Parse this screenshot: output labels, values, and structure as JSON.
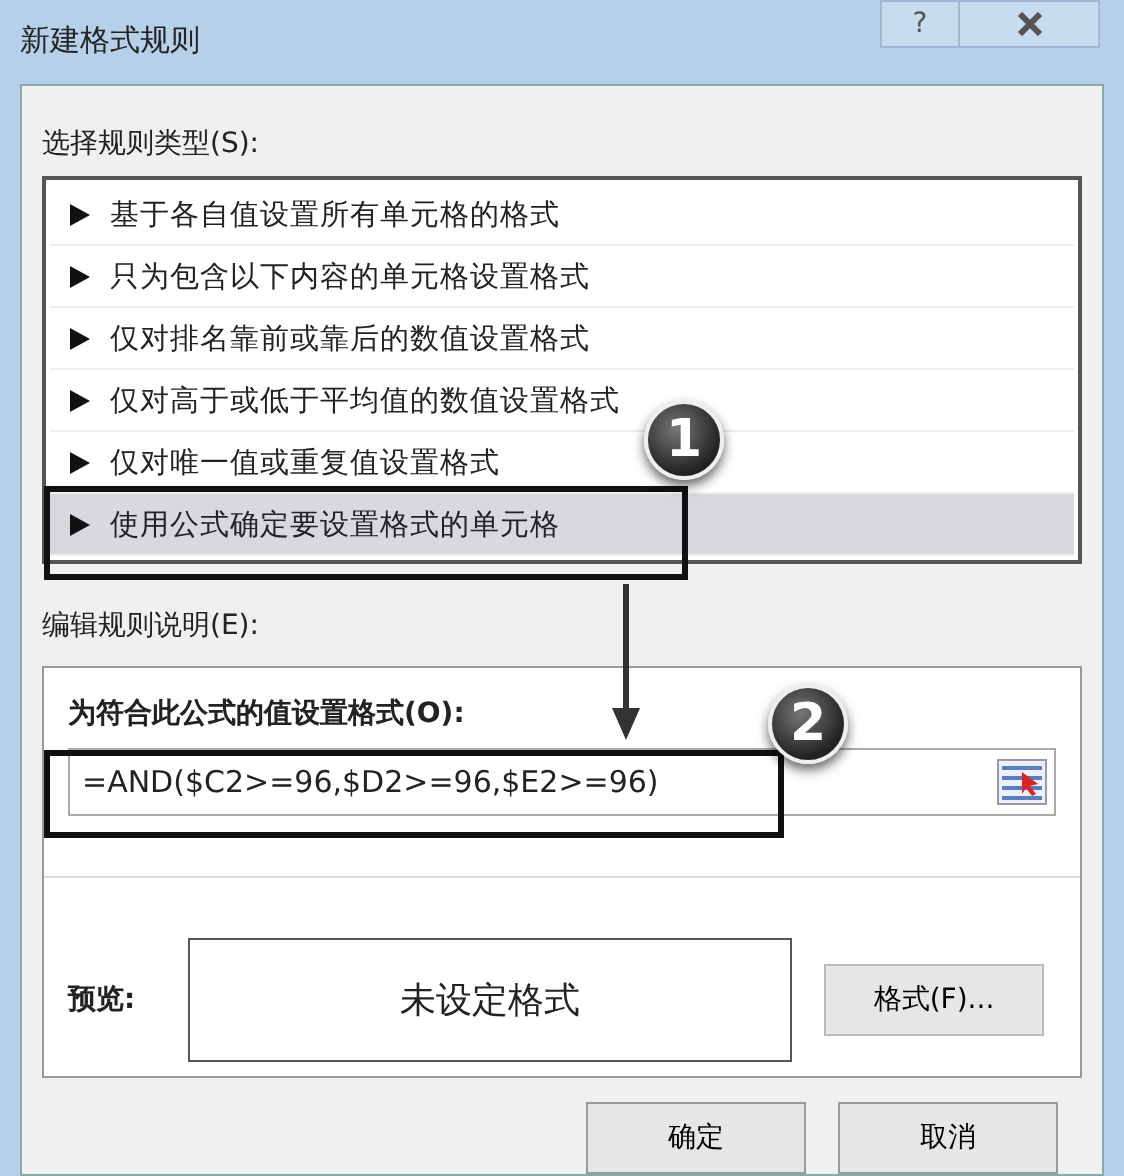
{
  "window": {
    "title": "新建格式规则",
    "help_button": "?"
  },
  "rule_type_label": "选择规则类型(S):",
  "rule_types": [
    {
      "label": "基于各自值设置所有单元格的格式",
      "selected": false
    },
    {
      "label": "只为包含以下内容的单元格设置格式",
      "selected": false
    },
    {
      "label": "仅对排名靠前或靠后的数值设置格式",
      "selected": false
    },
    {
      "label": "仅对高于或低于平均值的数值设置格式",
      "selected": false
    },
    {
      "label": "仅对唯一值或重复值设置格式",
      "selected": false
    },
    {
      "label": "使用公式确定要设置格式的单元格",
      "selected": true
    }
  ],
  "description_label": "编辑规则说明(E):",
  "formula_label": "为符合此公式的值设置格式(O):",
  "formula": "=AND($C2>=96,$D2>=96,$E2>=96)",
  "preview_label": "预览:",
  "preview_text": "未设定格式",
  "format_button": "格式(F)...",
  "buttons": [
    {
      "label": "确定"
    },
    {
      "label": "取消"
    }
  ],
  "callouts": [
    {
      "number": "1"
    },
    {
      "number": "2"
    }
  ]
}
